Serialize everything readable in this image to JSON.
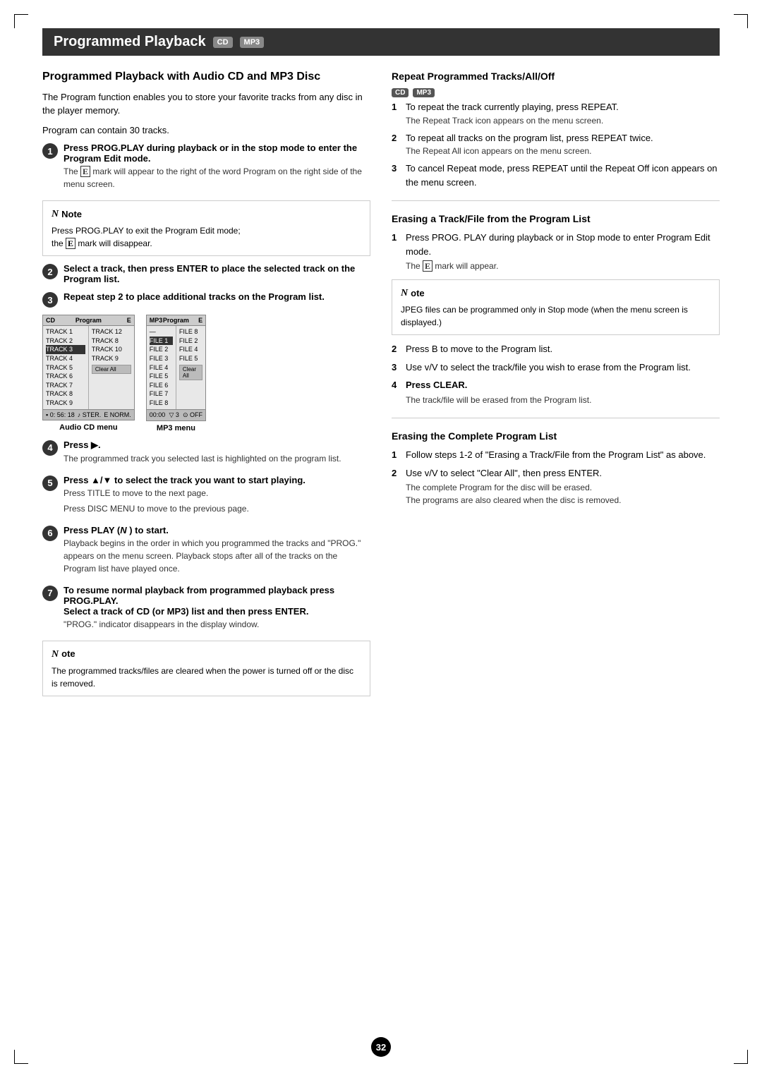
{
  "page": {
    "number": "32",
    "corner_marks": true
  },
  "title": {
    "text": "Programmed Playback",
    "badge_cd": "CD",
    "badge_mp3": "MP3"
  },
  "left_section": {
    "heading": "Programmed Playback with Audio CD and MP3 Disc",
    "intro1": "The Program function enables you to store your favorite tracks from any disc in the player memory.",
    "intro2": "Program can contain 30 tracks.",
    "step1": {
      "num": "1",
      "bold": "Press PROG.PLAY during playback or in the stop mode to enter the Program Edit mode.",
      "sub": "The  mark will appear to the right of the word Program on the right side of the menu screen."
    },
    "note1": {
      "title": "Note",
      "lines": [
        "Press PROG.PLAY to exit the Program Edit mode;",
        "the  mark will disappear."
      ]
    },
    "step2": {
      "num": "2",
      "bold": "Select a track, then press ENTER to place the selected track on the Program list."
    },
    "step3": {
      "num": "3",
      "bold": "Repeat step 2 to place additional tracks on the Program list."
    },
    "menu_cd": {
      "header_left": "CD",
      "header_right": "Program",
      "badge": "E",
      "col1": [
        "TRACK 1",
        "TRACK 2",
        "TRACK 3",
        "TRACK 4",
        "TRACK 5",
        "TRACK 6",
        "TRACK 7",
        "TRACK 8",
        "TRACK 9"
      ],
      "col2": [
        "TRACK 12",
        "TRACK 8",
        "TRACK 10",
        "TRACK 9"
      ],
      "highlighted_col1": "TRACK 3",
      "footer": "0: 56: 18  STER.  NORM.",
      "label": "Audio CD menu"
    },
    "menu_mp3": {
      "header_left": "MP3",
      "header_right": "Program",
      "badge": "E",
      "col1": [
        "—",
        "FILE 1",
        "FILE 2",
        "FILE 3",
        "FILE 4",
        "FILE 5",
        "FILE 6",
        "FILE 7",
        "FILE 8"
      ],
      "col2": [
        "FILE 8",
        "FILE 2",
        "FILE 4",
        "FILE 5"
      ],
      "highlighted_col1": "FILE 2",
      "footer": "00:00  3  OFF",
      "label": "MP3 menu"
    },
    "step4": {
      "num": "4",
      "bold": "Press ▶.",
      "sub": "The programmed track you selected last is highlighted on the program list."
    },
    "step5": {
      "num": "5",
      "bold": "Press ▲/▼ to select the track you want to start playing.",
      "sub1": "Press TITLE to move to the next page.",
      "sub2": "Press DISC MENU to move to the previous page."
    },
    "step6": {
      "num": "6",
      "bold": "Press PLAY (N ) to start.",
      "sub": "Playback begins in the order in which you programmed the tracks and \"PROG.\" appears on the menu screen. Playback stops after all of the tracks on the Program list have played once."
    },
    "step7": {
      "num": "7",
      "bold_line1": "To resume normal playback from programmed playback press PROG.PLAY.",
      "bold_line2": "Select a track of CD (or MP3) list and then press ENTER.",
      "sub": "\"PROG.\" indicator disappears in the display window."
    },
    "note2": {
      "title": "ote",
      "text": "The programmed tracks/files are cleared when the power is turned off or the disc is removed."
    }
  },
  "right_section": {
    "repeat_heading": "Repeat Programmed Tracks/All/Off",
    "repeat_badge_cd": "CD",
    "repeat_badge_mp3": "MP3",
    "repeat_steps": [
      {
        "num": "1",
        "text": "To repeat the track currently playing, press REPEAT.",
        "sub": "The Repeat Track icon appears on the menu screen."
      },
      {
        "num": "2",
        "text": "To repeat all tracks on the program list, press REPEAT twice.",
        "sub": "The Repeat All icon appears on the menu screen."
      },
      {
        "num": "3",
        "text": "To cancel Repeat mode, press REPEAT until the Repeat Off icon appears on the menu screen."
      }
    ],
    "erase_track_heading": "Erasing a Track/File from the Program List",
    "erase_track_steps": [
      {
        "num": "1",
        "text": "Press PROG. PLAY during playback or in Stop mode to enter Program Edit mode.",
        "sub": "The  mark will appear."
      }
    ],
    "erase_note": {
      "title": "ote",
      "text": "JPEG files can be programmed only in Stop mode (when the menu screen is displayed.)"
    },
    "erase_track_steps2": [
      {
        "num": "2",
        "text": "Press B to move to the Program list."
      },
      {
        "num": "3",
        "text": "Use v/V to select the track/file you wish to erase from the Program list."
      },
      {
        "num": "4",
        "bold": "Press CLEAR.",
        "sub": "The track/file will be erased from the Program list."
      }
    ],
    "erase_complete_heading": "Erasing the Complete Program List",
    "erase_complete_steps": [
      {
        "num": "1",
        "text": "Follow steps 1-2 of \"Erasing a Track/File from the Program List\" as above."
      },
      {
        "num": "2",
        "text": "Use v/V to select \"Clear All\", then press ENTER.",
        "sub1": "The complete Program for the disc will be erased.",
        "sub2": "The programs are also cleared when the disc is removed."
      }
    ]
  }
}
